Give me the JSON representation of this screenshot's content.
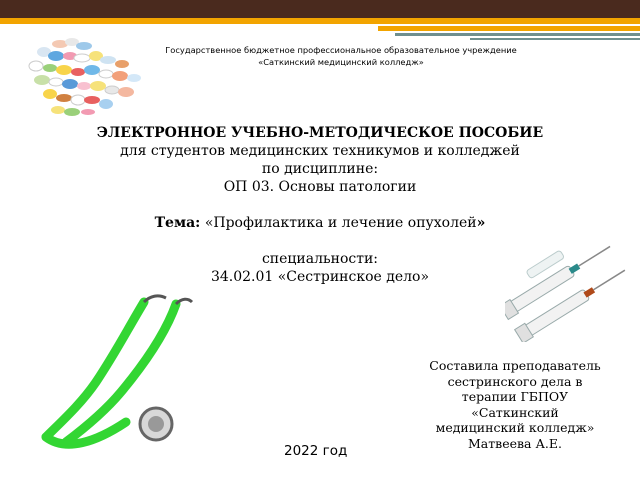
{
  "header": {
    "line1": "Государственное бюджетное  профессиональное образовательное учреждение",
    "line2": "«Саткинский медицинский колледж»"
  },
  "main": {
    "title": "ЭЛЕКТРОННОЕ УЧЕБНО-МЕТОДИЧЕСКОЕ ПОСОБИЕ",
    "audience": "для студентов медицинских техникумов  и колледжей",
    "discipline_label": "по дисциплине:",
    "discipline": "ОП 03. Основы патологии",
    "topic_label": "Тема:",
    "topic_open_quote": "«",
    "topic": "Профилактика и лечение опухолей",
    "topic_close_quote": "»",
    "specialty_label": "специальности:",
    "specialty": "34.02.01 «Сестринское дело»"
  },
  "author": {
    "line1": "Составила преподаватель",
    "line2": "сестринского дела в",
    "line3": "терапии ГБПОУ",
    "line4": "«Саткинский",
    "line5": "медицинский колледж»",
    "line6": "Матвеева А.Е."
  },
  "footer": {
    "year": "2022 год"
  },
  "colors": {
    "top_bar": "#4a2a1e",
    "accent": "#f2a400",
    "line": "#6f8f8f",
    "stethoscope": "#33d633"
  },
  "images": {
    "pills": "pills-image",
    "stethoscope": "stethoscope-image",
    "syringes": "syringes-image"
  }
}
